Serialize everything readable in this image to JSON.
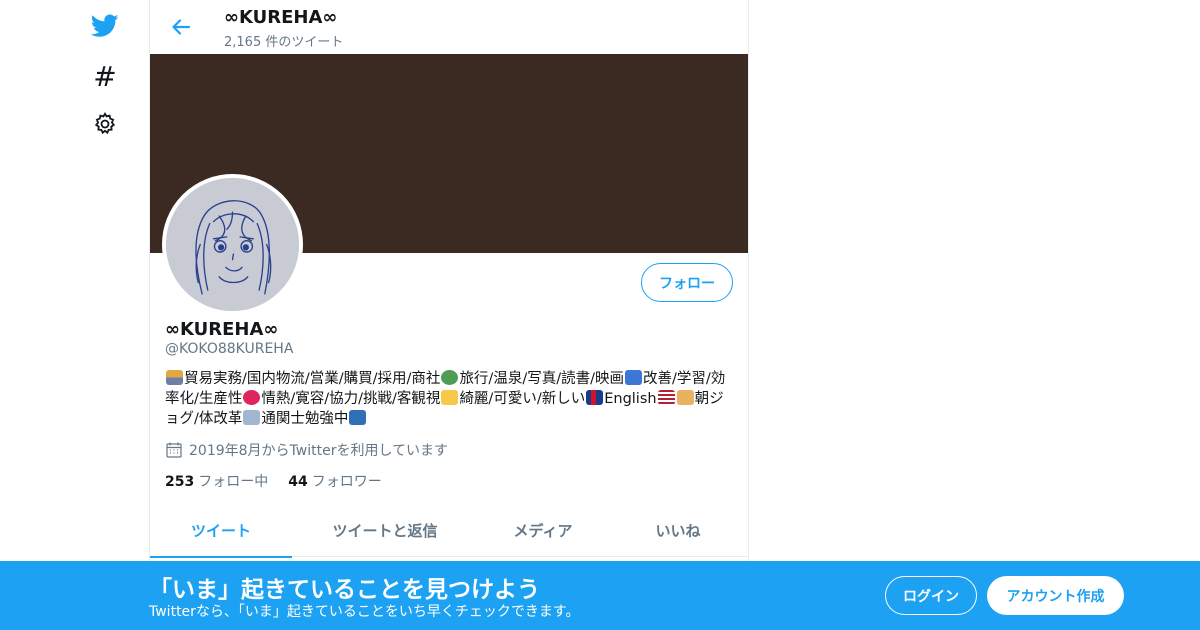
{
  "colors": {
    "accent": "#1da1f2",
    "banner": "#3a2a22",
    "muted": "#657786",
    "text": "#14171a"
  },
  "nav": {
    "icons": [
      "twitter-bird-icon",
      "hashtag-icon",
      "gear-icon"
    ],
    "hashtag_glyph": "#"
  },
  "header": {
    "name": "∞KUREHA∞",
    "tweet_count": "2,165 件のツイート"
  },
  "profile": {
    "name": "∞KUREHA∞",
    "handle": "@KOKO88KUREHA",
    "follow_label": "フォロー",
    "bio": {
      "seg1": "貿易実務/国内物流/営業/購買/採用/商社",
      "seg2": "旅行/温泉/写真/読書/映画",
      "seg3": "改善/学習/効率化/生産性",
      "seg4": "情熱/寛容/協力/挑戦/客観視",
      "seg5": "綺麗/可愛い/新しい",
      "seg6": "English",
      "seg7": "朝ジョグ/体改革",
      "seg8": "通関士勉強中"
    },
    "joined": "2019年8月からTwitterを利用しています",
    "following_count": "253",
    "following_label": "フォロー中",
    "followers_count": "44",
    "followers_label": "フォロワー"
  },
  "tabs": [
    "ツイート",
    "ツイートと返信",
    "メディア",
    "いいね"
  ],
  "bottom_bar": {
    "title": "「いま」起きていることを見つけよう",
    "subtitle": "Twitterなら、「いま」起きていることをいち早くチェックできます。",
    "login_label": "ログイン",
    "signup_label": "アカウント作成"
  }
}
